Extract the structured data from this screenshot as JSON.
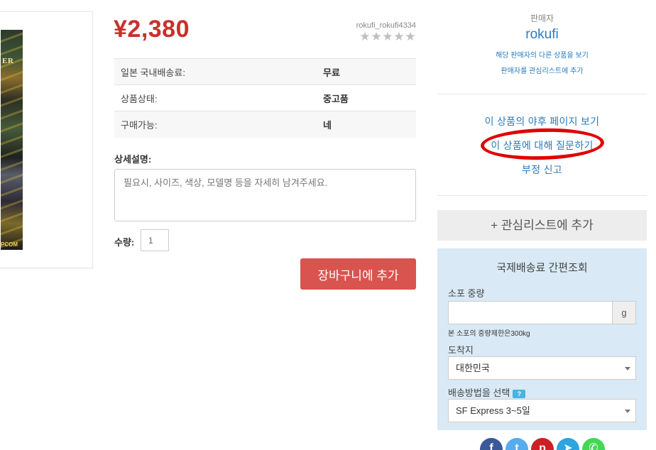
{
  "product": {
    "image_alt_text_top": "ER",
    "image_alt_text_bottom": "PCOM",
    "price": "¥2,380",
    "seller_id": "rokufi_rokufi4334",
    "rating_stars": 0,
    "specs": [
      {
        "label": "일본 국내배송료:",
        "value": "무료"
      },
      {
        "label": "상품상태:",
        "value": "중고품"
      },
      {
        "label": "구매가능:",
        "value": "네"
      }
    ],
    "description_label": "상세설명:",
    "description_placeholder": "필요시, 사이즈, 색상, 모델명 등을 자세히 남겨주세요.",
    "quantity_label": "수량:",
    "quantity_value": "1",
    "add_to_cart_label": "장바구니에 추가"
  },
  "seller": {
    "heading": "판매자",
    "name": "rokufi",
    "link_other_items": "해당 판매자의 다른 상품을 보기",
    "link_add_watchlist": "판매자를 관심리스트에 추가"
  },
  "actions": {
    "view_yahoo_page": "이 상품의 야후 페이지 보기",
    "ask_question": "이 상품에 대해 질문하기",
    "report": "부정 신고",
    "add_watchlist": "+ 관심리스트에 추가"
  },
  "shipping": {
    "title": "국제배송료 간편조회",
    "weight_label": "소포 중량",
    "weight_unit": "g",
    "weight_note": "본 소포의 중량제한은300kg",
    "destination_label": "도착지",
    "destination_value": "대한민국",
    "method_label": "배송방법을 선택",
    "method_help": "?",
    "method_value": "SF Express 3~5일"
  },
  "colors": {
    "price_red": "#c9302c",
    "link_blue": "#2a7bbf",
    "cart_button": "#d9534f",
    "shipping_panel": "#d9e9f5",
    "highlight_ellipse": "#e00000"
  },
  "social_icons": [
    "facebook-icon",
    "twitter-icon",
    "pinterest-icon",
    "telegram-icon",
    "whatsapp-icon"
  ]
}
